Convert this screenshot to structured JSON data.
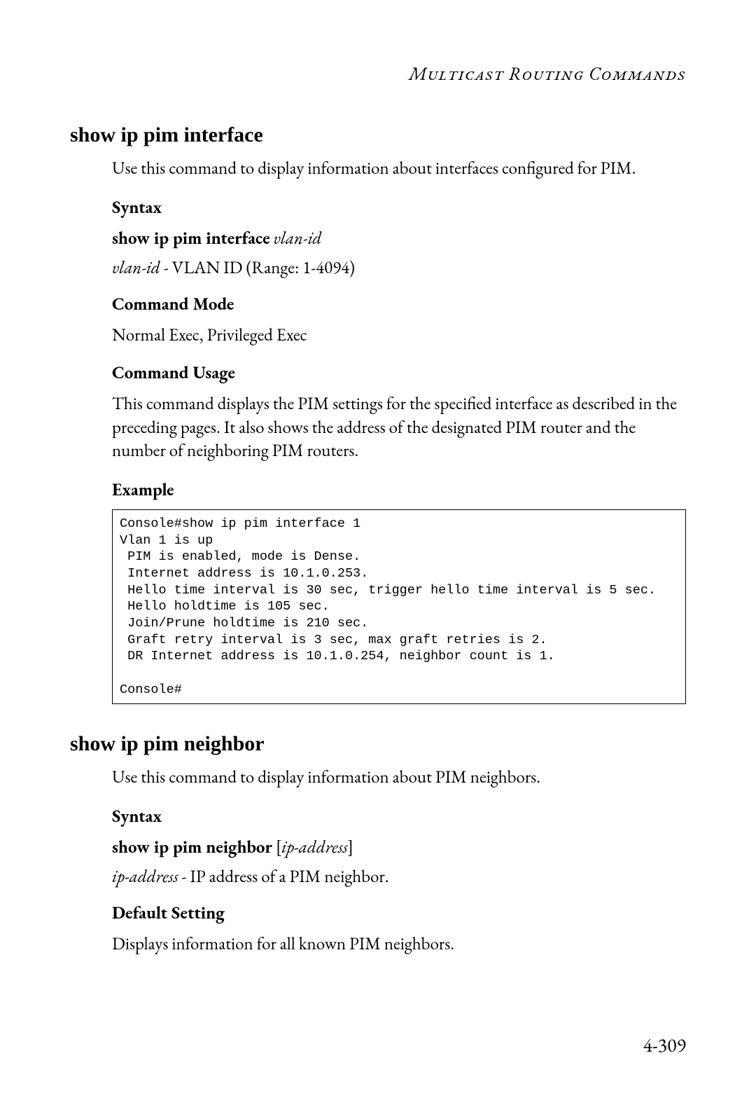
{
  "header": {
    "running_title": "Multicast Routing Commands"
  },
  "sections": [
    {
      "title": "show ip pim interface",
      "description": "Use this command to display information about interfaces configured for PIM.",
      "syntax": {
        "heading": "Syntax",
        "command_bold": "show ip pim interface",
        "command_ital": "vlan-id",
        "param_ital": "vlan-id",
        "param_desc": " - VLAN ID (Range: 1-4094)"
      },
      "mode": {
        "heading": "Command Mode",
        "text": "Normal Exec, Privileged Exec"
      },
      "usage": {
        "heading": "Command Usage",
        "text": "This command displays the PIM settings for the specified interface as described in the preceding pages. It also shows the address of the designated PIM router and the number of neighboring PIM routers."
      },
      "example": {
        "heading": "Example",
        "console": "Console#show ip pim interface 1\nVlan 1 is up\n PIM is enabled, mode is Dense.\n Internet address is 10.1.0.253.\n Hello time interval is 30 sec, trigger hello time interval is 5 sec.\n Hello holdtime is 105 sec.\n Join/Prune holdtime is 210 sec.\n Graft retry interval is 3 sec, max graft retries is 2.\n DR Internet address is 10.1.0.254, neighbor count is 1.\n\nConsole#"
      }
    },
    {
      "title": "show ip pim neighbor",
      "description": "Use this command to display information about PIM neighbors.",
      "syntax": {
        "heading": "Syntax",
        "command_bold": "show ip pim neighbor",
        "command_plain_open": " [",
        "command_ital": "ip-address",
        "command_plain_close": "]",
        "param_ital": "ip-address",
        "param_desc": " - IP address of a PIM neighbor."
      },
      "default": {
        "heading": "Default Setting",
        "text": "Displays information for all known PIM neighbors."
      }
    }
  ],
  "footer": {
    "page_number": "4-309"
  }
}
